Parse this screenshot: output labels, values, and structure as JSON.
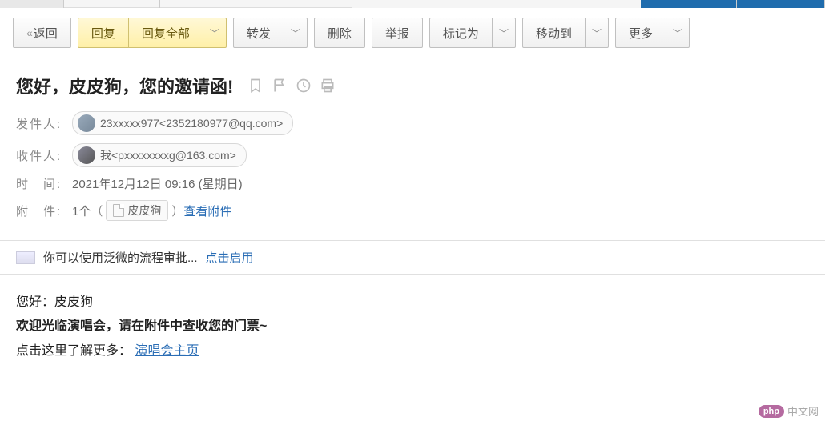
{
  "toolbar": {
    "back_label": "返回",
    "reply_label": "回复",
    "reply_all_label": "回复全部",
    "forward_label": "转发",
    "delete_label": "删除",
    "report_label": "举报",
    "mark_as_label": "标记为",
    "move_to_label": "移动到",
    "more_label": "更多"
  },
  "email": {
    "subject": "您好，皮皮狗，您的邀请函!",
    "labels": {
      "from": "发件人:",
      "to": "收件人:",
      "time": "时　间:",
      "attach": "附　件:"
    },
    "from": {
      "display": "23xxxxx977<2352180977@qq.com>"
    },
    "to": {
      "display": "我<pxxxxxxxxg@163.com>"
    },
    "time": "2021年12月12日 09:16 (星期日)",
    "attachment": {
      "count_text": "1个",
      "name": "皮皮狗",
      "view_label": "查看附件"
    }
  },
  "tip": {
    "text": "你可以使用泛微的流程审批...",
    "action": "点击启用"
  },
  "body": {
    "greeting": "您好：皮皮狗",
    "main": "欢迎光临演唱会，请在附件中查收您的门票~",
    "link_prefix": "点击这里了解更多：",
    "link_text": "演唱会主页"
  },
  "footer": {
    "badge": "php",
    "text": "中文网"
  }
}
